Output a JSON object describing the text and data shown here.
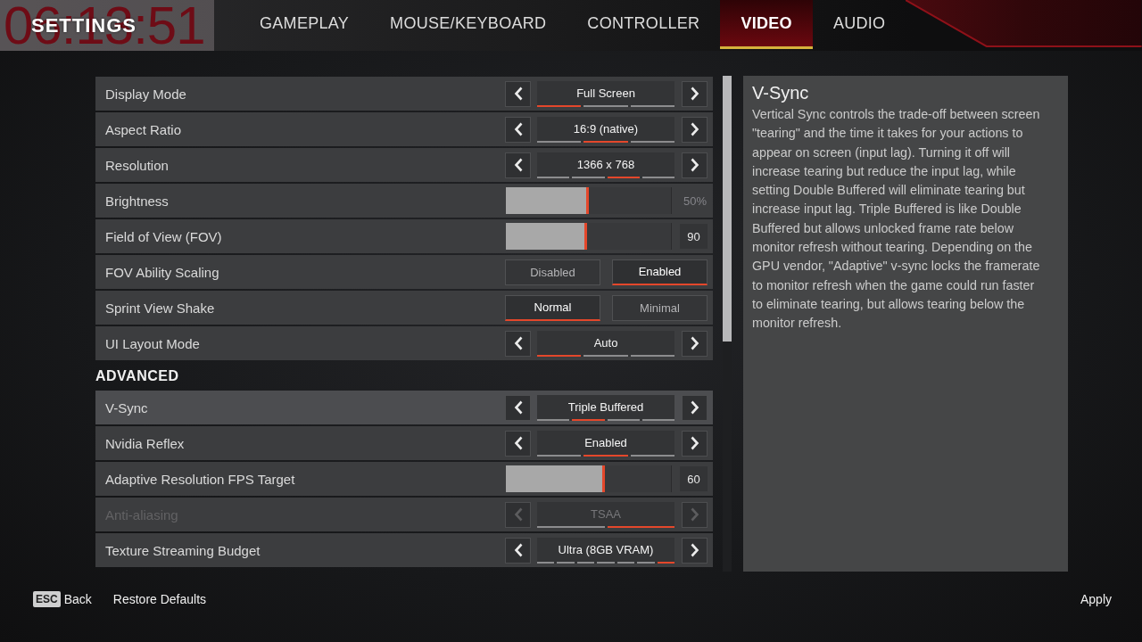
{
  "timer_overlay": {
    "time": "06:13:51"
  },
  "header": {
    "title": "SETTINGS",
    "tabs": [
      {
        "label": "GAMEPLAY",
        "selected": false
      },
      {
        "label": "MOUSE/KEYBOARD",
        "selected": false
      },
      {
        "label": "CONTROLLER",
        "selected": false
      },
      {
        "label": "VIDEO",
        "selected": true
      },
      {
        "label": "AUDIO",
        "selected": false
      }
    ]
  },
  "settings": {
    "rows": [
      {
        "label": "Display Mode",
        "kind": "carousel",
        "selected": false,
        "disabled": false,
        "value": "Full Screen",
        "segments": [
          {
            "selected": true
          },
          {
            "selected": false
          },
          {
            "selected": false
          }
        ]
      },
      {
        "label": "Aspect Ratio",
        "kind": "carousel",
        "selected": false,
        "disabled": false,
        "value": "16:9 (native)",
        "segments": [
          {
            "selected": false
          },
          {
            "selected": true
          },
          {
            "selected": false
          }
        ]
      },
      {
        "label": "Resolution",
        "kind": "carousel",
        "selected": false,
        "disabled": false,
        "value": "1366 x 768",
        "segments": [
          {
            "selected": false
          },
          {
            "selected": false
          },
          {
            "selected": true
          },
          {
            "selected": false
          }
        ]
      },
      {
        "label": "Brightness",
        "kind": "slider",
        "selected": false,
        "disabled": false,
        "level": 0.5,
        "reading": "50%",
        "reading_field": false
      },
      {
        "label": "Field of View (FOV)",
        "kind": "slider",
        "selected": false,
        "disabled": false,
        "level": 0.49,
        "reading": "90",
        "reading_field": true
      },
      {
        "label": "FOV Ability Scaling",
        "kind": "toggle",
        "selected": false,
        "disabled": false,
        "options": [
          {
            "label": "Disabled",
            "selected": false
          },
          {
            "label": "Enabled",
            "selected": true
          }
        ]
      },
      {
        "label": "Sprint View Shake",
        "kind": "toggle",
        "selected": false,
        "disabled": false,
        "options": [
          {
            "label": "Normal",
            "selected": true
          },
          {
            "label": "Minimal",
            "selected": false
          }
        ]
      },
      {
        "label": "UI Layout Mode",
        "kind": "carousel",
        "selected": false,
        "disabled": false,
        "value": "Auto",
        "segments": [
          {
            "selected": true
          },
          {
            "selected": false
          },
          {
            "selected": false
          }
        ]
      }
    ]
  },
  "advanced": {
    "heading": "ADVANCED",
    "rows": [
      {
        "label": "V-Sync",
        "kind": "carousel",
        "selected": true,
        "disabled": false,
        "value": "Triple Buffered",
        "segments": [
          {
            "selected": false
          },
          {
            "selected": true
          },
          {
            "selected": false
          },
          {
            "selected": false
          }
        ]
      },
      {
        "label": "Nvidia Reflex",
        "kind": "carousel",
        "selected": false,
        "disabled": false,
        "value": "Enabled",
        "segments": [
          {
            "selected": false
          },
          {
            "selected": true
          },
          {
            "selected": false
          }
        ]
      },
      {
        "label": "Adaptive Resolution FPS Target",
        "kind": "slider",
        "selected": false,
        "disabled": false,
        "level": 0.6,
        "reading": "60",
        "reading_field": true
      },
      {
        "label": "Anti-aliasing",
        "kind": "carousel",
        "selected": false,
        "disabled": true,
        "value": "TSAA",
        "segments": [
          {
            "selected": false
          },
          {
            "selected": true
          }
        ]
      },
      {
        "label": "Texture Streaming Budget",
        "kind": "carousel",
        "selected": false,
        "disabled": false,
        "value": "Ultra (8GB VRAM)",
        "segments": [
          {
            "selected": false
          },
          {
            "selected": false
          },
          {
            "selected": false
          },
          {
            "selected": false
          },
          {
            "selected": false
          },
          {
            "selected": false
          },
          {
            "selected": true
          }
        ]
      }
    ]
  },
  "description": {
    "title": "V-Sync",
    "text": "Vertical Sync controls the trade-off between screen \"tearing\" and the time it takes for your actions to appear on screen (input lag). Turning it off will increase tearing but reduce the input lag, while setting Double Buffered will eliminate tearing but increase input lag. Triple Buffered is like Double Buffered but allows unlocked frame rate below monitor refresh without tearing. Depending on the GPU vendor, \"Adaptive\" v-sync locks the framerate to monitor refresh when the game could run faster to eliminate tearing, but allows tearing below the monitor refresh."
  },
  "footer": {
    "back": {
      "key": "ESC",
      "label": "Back"
    },
    "restore_defaults": "Restore Defaults",
    "apply": "Apply"
  }
}
